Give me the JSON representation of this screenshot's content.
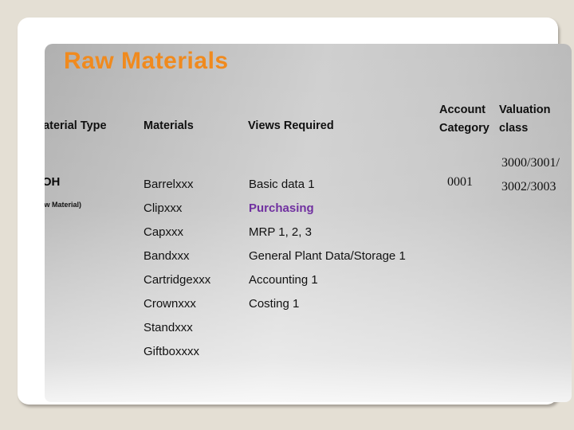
{
  "slide": {
    "title": "Raw Materials",
    "title_color": "#F08A1E",
    "accent_color": "#7030A0",
    "background_color": "#E4DFD4"
  },
  "table": {
    "headers": {
      "material_type": "Material Type",
      "materials": "Materials",
      "views_required": "Views Required",
      "account_category_line1": "Account",
      "account_category_line2": "Category",
      "valuation_class_line1": "Valuation",
      "valuation_class_line2": "class"
    },
    "row": {
      "material_type_code": "ROH",
      "material_type_description": "(Raw Material)",
      "materials": [
        "Barrelxxx",
        "Clipxxx",
        "Capxxx",
        "Bandxxx",
        "Cartridgexxx",
        "Crownxxx",
        "Standxxx",
        "Giftboxxxx"
      ],
      "views_required": [
        {
          "label": "Basic data 1",
          "highlighted": false
        },
        {
          "label": "Purchasing",
          "highlighted": true
        },
        {
          "label": "MRP 1, 2, 3",
          "highlighted": false
        },
        {
          "label": "General Plant Data/Storage 1",
          "highlighted": false
        },
        {
          "label": "Accounting 1",
          "highlighted": false
        },
        {
          "label": "Costing 1",
          "highlighted": false
        }
      ],
      "account_category": "0001",
      "valuation_class_line1": "3000/3001/",
      "valuation_class_line2": "3002/3003"
    }
  }
}
